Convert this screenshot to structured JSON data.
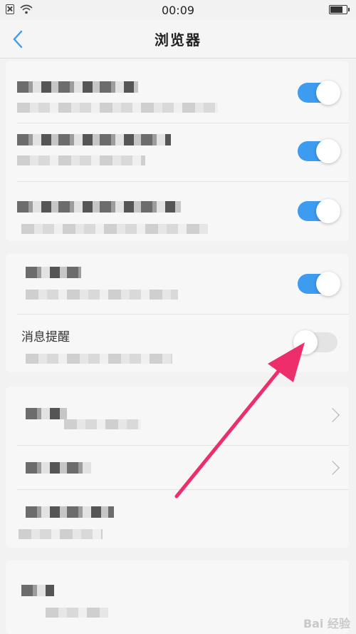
{
  "status_bar": {
    "time": "00:09"
  },
  "nav": {
    "title": "浏览器"
  },
  "notification_row": {
    "label": "消息提醒",
    "toggle": "off"
  },
  "toggles": {
    "row1": "on",
    "row2": "on",
    "row3": "on",
    "row4": "on"
  },
  "watermark": "Bai 经验",
  "colors": {
    "toggle_on": "#3d9bf0",
    "arrow": "#ee2e6b",
    "back": "#3d9bf0"
  }
}
